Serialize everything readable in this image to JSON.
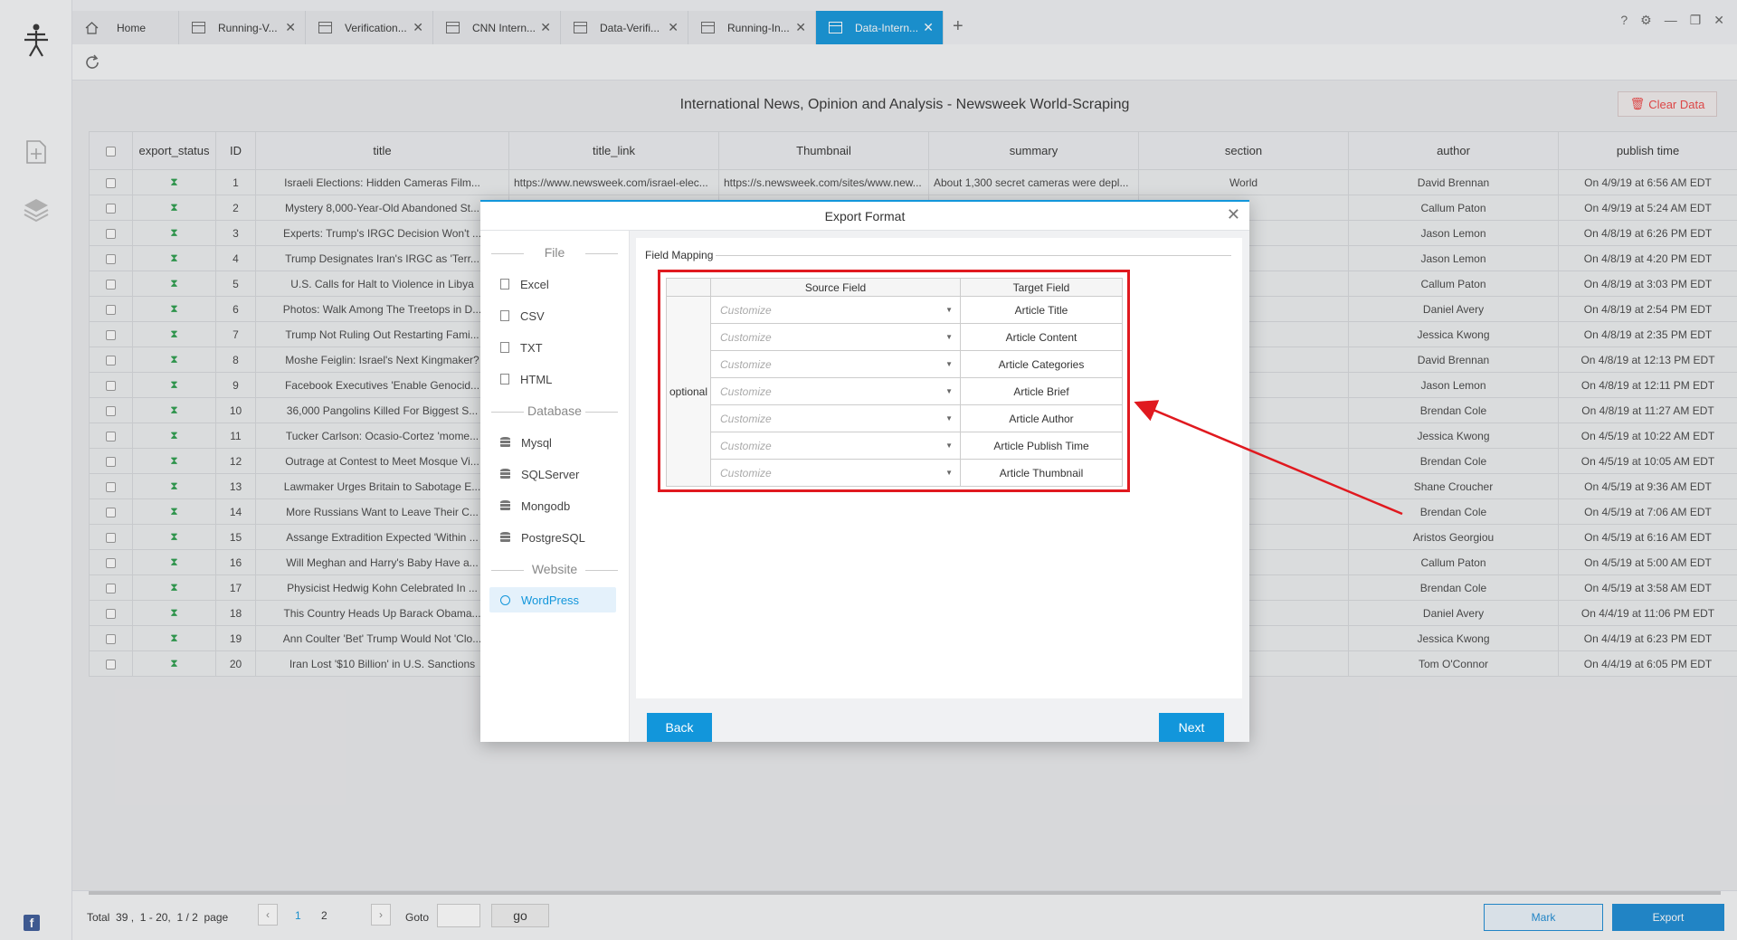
{
  "tabs": [
    {
      "label": "Home",
      "icon": "home-icon"
    },
    {
      "label": "Running-V...",
      "icon": "window-icon"
    },
    {
      "label": "Verification...",
      "icon": "window-icon"
    },
    {
      "label": "CNN Intern...",
      "icon": "window-icon"
    },
    {
      "label": "Data-Verifi...",
      "icon": "window-icon"
    },
    {
      "label": "Running-In...",
      "icon": "window-icon"
    },
    {
      "label": "Data-Intern...",
      "icon": "window-icon",
      "active": true
    }
  ],
  "page": {
    "title": "International News, Opinion and Analysis - Newsweek World-Scraping",
    "clear_label": "Clear Data"
  },
  "table": {
    "headers": [
      "",
      "export_status",
      "ID",
      "title",
      "title_link",
      "Thumbnail",
      "summary",
      "section",
      "author",
      "publish time"
    ],
    "first_row_extra": {
      "title_link": "https://www.newsweek.com/israel-elec...",
      "thumbnail": "https://s.newsweek.com/sites/www.new...",
      "summary": "About 1,300 secret cameras were depl...",
      "section": "World"
    },
    "partial_link": "ht",
    "rows": [
      {
        "id": "1",
        "title": "Israeli Elections: Hidden Cameras Film...",
        "author": "David Brennan",
        "time": "On 4/9/19 at 6:56 AM EDT"
      },
      {
        "id": "2",
        "title": "Mystery 8,000-Year-Old Abandoned St...",
        "author": "Callum Paton",
        "time": "On 4/9/19 at 5:24 AM EDT"
      },
      {
        "id": "3",
        "title": "Experts: Trump's IRGC Decision Won't ...",
        "author": "Jason Lemon",
        "time": "On 4/8/19 at 6:26 PM EDT"
      },
      {
        "id": "4",
        "title": "Trump Designates Iran's IRGC as 'Terr...",
        "author": "Jason Lemon",
        "time": "On 4/8/19 at 4:20 PM EDT"
      },
      {
        "id": "5",
        "title": "U.S. Calls for Halt to Violence in Libya",
        "author": "Callum Paton",
        "time": "On 4/8/19 at 3:03 PM EDT"
      },
      {
        "id": "6",
        "title": "Photos: Walk Among The Treetops in D...",
        "author": "Daniel Avery",
        "time": "On 4/8/19 at 2:54 PM EDT"
      },
      {
        "id": "7",
        "title": "Trump Not Ruling Out Restarting Fami...",
        "author": "Jessica Kwong",
        "time": "On 4/8/19 at 2:35 PM EDT"
      },
      {
        "id": "8",
        "title": "Moshe Feiglin: Israel's Next Kingmaker?",
        "author": "David Brennan",
        "time": "On 4/8/19 at 12:13 PM EDT"
      },
      {
        "id": "9",
        "title": "Facebook Executives 'Enable Genocid...",
        "author": "Jason Lemon",
        "time": "On 4/8/19 at 12:11 PM EDT"
      },
      {
        "id": "10",
        "title": "36,000 Pangolins Killed For Biggest S...",
        "author": "Brendan Cole",
        "time": "On 4/8/19 at 11:27 AM EDT"
      },
      {
        "id": "11",
        "title": "Tucker Carlson: Ocasio-Cortez 'mome...",
        "author": "Jessica Kwong",
        "time": "On 4/5/19 at 10:22 AM EDT"
      },
      {
        "id": "12",
        "title": "Outrage at Contest to Meet Mosque Vi...",
        "author": "Brendan Cole",
        "time": "On 4/5/19 at 10:05 AM EDT"
      },
      {
        "id": "13",
        "title": "Lawmaker Urges Britain to Sabotage E...",
        "author": "Shane Croucher",
        "time": "On 4/5/19 at 9:36 AM EDT"
      },
      {
        "id": "14",
        "title": "More Russians Want to Leave Their C...",
        "author": "Brendan Cole",
        "time": "On 4/5/19 at 7:06 AM EDT"
      },
      {
        "id": "15",
        "title": "Assange Extradition Expected 'Within ...",
        "author": "Aristos Georgiou",
        "time": "On 4/5/19 at 6:16 AM EDT"
      },
      {
        "id": "16",
        "title": "Will Meghan and Harry's Baby Have a...",
        "author": "Callum Paton",
        "time": "On 4/5/19 at 5:00 AM EDT"
      },
      {
        "id": "17",
        "title": "Physicist Hedwig Kohn Celebrated In ...",
        "author": "Brendan Cole",
        "time": "On 4/5/19 at 3:58 AM EDT"
      },
      {
        "id": "18",
        "title": "This Country Heads Up Barack Obama...",
        "author": "Daniel Avery",
        "time": "On 4/4/19 at 11:06 PM EDT"
      },
      {
        "id": "19",
        "title": "Ann Coulter 'Bet' Trump Would Not 'Clo...",
        "author": "Jessica Kwong",
        "time": "On 4/4/19 at 6:23 PM EDT"
      },
      {
        "id": "20",
        "title": "Iran Lost '$10 Billion' in U.S. Sanctions",
        "author": "Tom O'Connor",
        "time": "On 4/4/19 at 6:05 PM EDT"
      }
    ]
  },
  "footer": {
    "total_label": "Total",
    "total": "39",
    "range": "1 - 20,",
    "pages": "1 / 2",
    "page_word": "page",
    "page1": "1",
    "page2": "2",
    "goto_label": "Goto",
    "go_label": "go",
    "mark_label": "Mark",
    "export_label": "Export"
  },
  "modal": {
    "title": "Export Format",
    "groups": {
      "file": "File",
      "database": "Database",
      "website": "Website"
    },
    "file_items": [
      "Excel",
      "CSV",
      "TXT",
      "HTML"
    ],
    "db_items": [
      "Mysql",
      "SQLServer",
      "Mongodb",
      "PostgreSQL"
    ],
    "web_items": [
      "WordPress"
    ],
    "field_mapping_label": "Field Mapping",
    "mapping": {
      "source_header": "Source Field",
      "target_header": "Target Field",
      "optional_label": "optional",
      "placeholder": "Customize",
      "targets": [
        "Article Title",
        "Article Content",
        "Article Categories",
        "Article Brief",
        "Article Author",
        "Article Publish Time",
        "Article Thumbnail"
      ]
    },
    "back_label": "Back",
    "next_label": "Next"
  },
  "colors": {
    "accent": "#1296db",
    "highlight": "#e0191f",
    "status_green": "#2a9d4b"
  }
}
